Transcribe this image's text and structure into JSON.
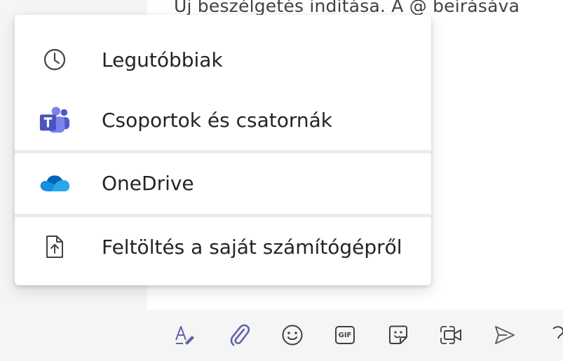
{
  "compose": {
    "placeholder_text": "Új beszélgetés indítása. A @ beírásáva"
  },
  "attach_menu": {
    "items": [
      {
        "label": "Legutóbbiak",
        "icon": "clock-icon"
      },
      {
        "label": "Csoportok és csatornák",
        "icon": "teams-icon"
      },
      {
        "label": "OneDrive",
        "icon": "onedrive-icon"
      },
      {
        "label": "Feltöltés a saját számítógépről",
        "icon": "upload-file-icon"
      }
    ]
  },
  "toolbar": {
    "buttons": [
      {
        "icon": "format-icon"
      },
      {
        "icon": "attach-icon"
      },
      {
        "icon": "emoji-icon"
      },
      {
        "icon": "gif-icon",
        "label": "GIF"
      },
      {
        "icon": "sticker-icon"
      },
      {
        "icon": "meet-now-icon"
      },
      {
        "icon": "send-icon"
      }
    ]
  },
  "colors": {
    "accent": "#6264a7",
    "teams_purple": "#5059c9",
    "onedrive_blue": "#0f78d4",
    "text": "#242424",
    "background": "#f5f5f5"
  }
}
